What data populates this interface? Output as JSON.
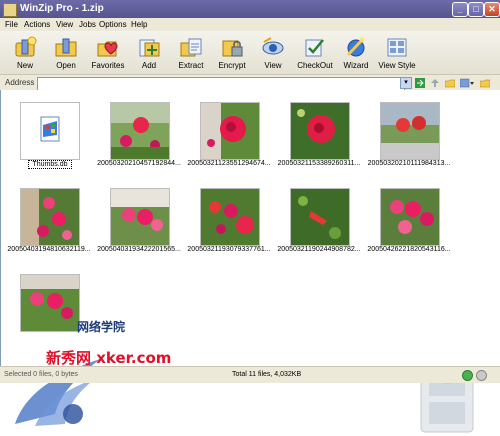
{
  "window": {
    "title": "WinZip Pro - 1.zip"
  },
  "title_buttons": {
    "minimize": "_",
    "maximize": "□",
    "close": "✕"
  },
  "menu": [
    "File",
    "Actions",
    "View",
    "Jobs",
    "Options",
    "Help"
  ],
  "toolbar": [
    {
      "label": "New",
      "icon": "new-icon"
    },
    {
      "label": "Open",
      "icon": "open-icon"
    },
    {
      "label": "Favorites",
      "icon": "favorites-icon"
    },
    {
      "label": "Add",
      "icon": "add-icon"
    },
    {
      "label": "Extract",
      "icon": "extract-icon"
    },
    {
      "label": "Encrypt",
      "icon": "encrypt-icon"
    },
    {
      "label": "View",
      "icon": "view-icon"
    },
    {
      "label": "CheckOut",
      "icon": "checkout-icon"
    },
    {
      "label": "Wizard",
      "icon": "wizard-icon"
    },
    {
      "label": "View Style",
      "icon": "view-style-icon"
    }
  ],
  "address": {
    "label": "Address",
    "value": ""
  },
  "files": [
    {
      "name": "Thumbs.db",
      "kind": "file"
    },
    {
      "name": "20050320210457192844...",
      "kind": "photo"
    },
    {
      "name": "20050321123551294674...",
      "kind": "photo"
    },
    {
      "name": "20050321153389260311...",
      "kind": "photo"
    },
    {
      "name": "20050320210111984313...",
      "kind": "photo"
    },
    {
      "name": "20050403194810632119...",
      "kind": "photo"
    },
    {
      "name": "20050403193422201565...",
      "kind": "photo"
    },
    {
      "name": "20050321193079337761...",
      "kind": "photo"
    },
    {
      "name": "20050321190244908782...",
      "kind": "photo"
    },
    {
      "name": "20050426221820543116...",
      "kind": "photo"
    },
    {
      "name": "",
      "kind": "photo"
    }
  ],
  "status": {
    "left": "Selected 0 files, 0 bytes",
    "total": "Total 11 files, 4,032KB"
  },
  "watermark": {
    "line1": "网络学院",
    "line2": "新秀网 xker.com"
  },
  "colors": {
    "titlebar": "#6C6AA8",
    "chrome": "#ECE9D8",
    "accent_red": "#E0102A"
  }
}
